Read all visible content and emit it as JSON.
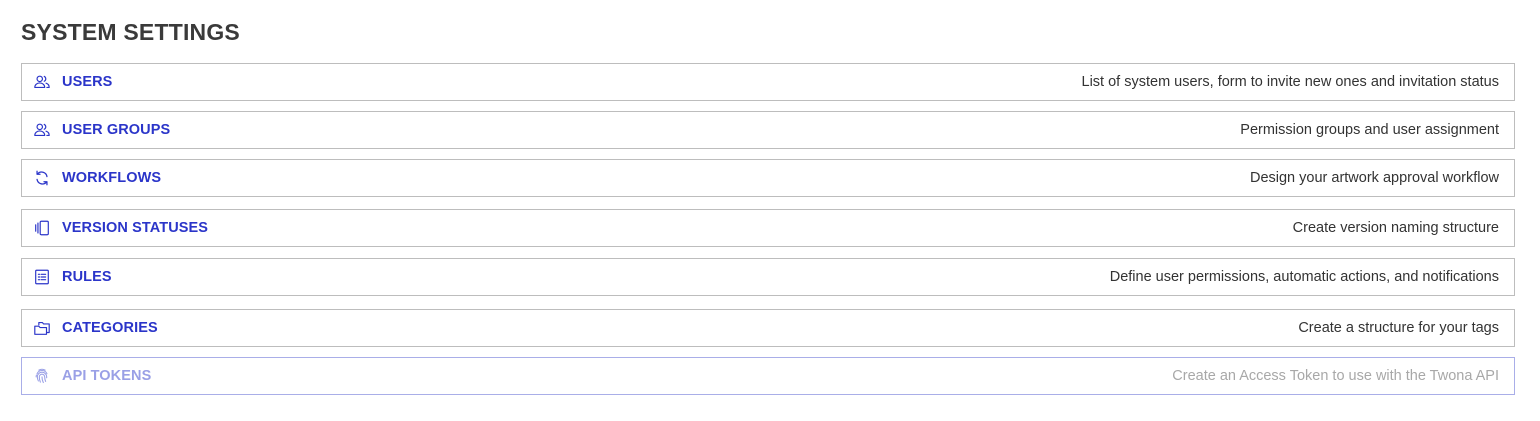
{
  "page": {
    "title": "SYSTEM SETTINGS"
  },
  "colors": {
    "accent": "#2b35c9",
    "accent_disabled": "#9aa0e6",
    "description": "#333333",
    "description_disabled": "#a8a8a8",
    "border": "#bdbdbd",
    "border_disabled": "#a9aee8"
  },
  "settings": [
    {
      "icon": "users-icon",
      "title": "USERS",
      "description": "List of system users, form to invite new ones and invitation status",
      "disabled": false
    },
    {
      "icon": "user-groups-icon",
      "title": "USER GROUPS",
      "description": "Permission groups and user assignment",
      "disabled": false
    },
    {
      "icon": "refresh-icon",
      "title": "WORKFLOWS",
      "description": "Design your artwork approval workflow",
      "disabled": false
    },
    {
      "icon": "versions-icon",
      "title": "VERSION STATUSES",
      "description": "Create version naming structure",
      "disabled": false
    },
    {
      "icon": "checklist-icon",
      "title": "RULES",
      "description": "Define user permissions, automatic actions, and notifications",
      "disabled": false
    },
    {
      "icon": "folders-icon",
      "title": "CATEGORIES",
      "description": "Create a structure for your tags",
      "disabled": false
    },
    {
      "icon": "fingerprint-icon",
      "title": "API TOKENS",
      "description": "Create an Access Token to use with the Twona API",
      "disabled": true
    }
  ]
}
